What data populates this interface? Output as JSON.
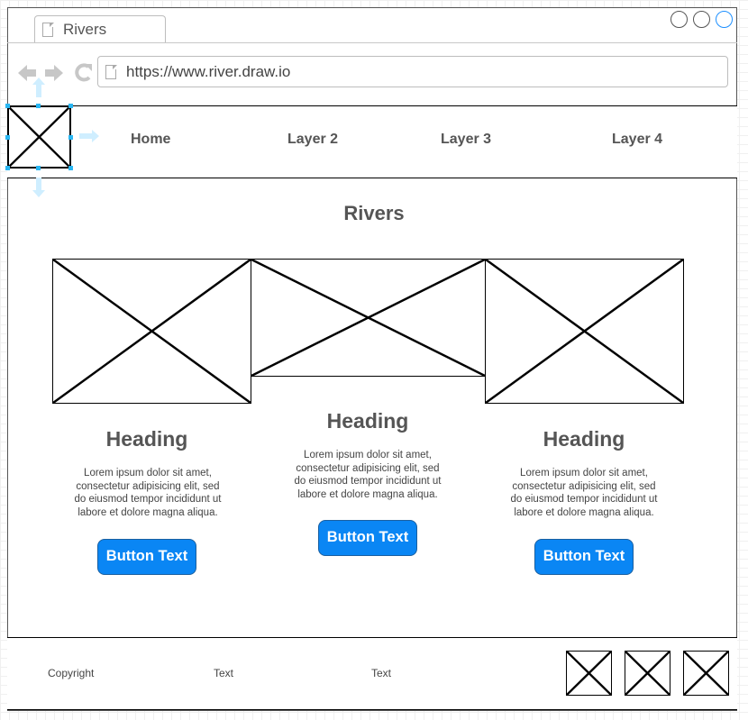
{
  "browser": {
    "tab_title": "Rivers",
    "url": "https://www.river.draw.io"
  },
  "nav": {
    "items": [
      "Home",
      "Layer 2",
      "Layer 3",
      "Layer 4"
    ]
  },
  "main": {
    "title": "Rivers",
    "cards": [
      {
        "heading": "Heading",
        "body_lines": [
          "Lorem ipsum dolor sit amet,",
          "consectetur adipisicing elit, sed",
          "do eiusmod tempor incididunt ut",
          "labore et dolore magna aliqua."
        ],
        "button": "Button Text"
      },
      {
        "heading": "Heading",
        "body_lines": [
          "Lorem ipsum dolor sit amet,",
          "consectetur adipisicing elit, sed",
          "do eiusmod tempor incididunt ut",
          "labore et dolore magna aliqua."
        ],
        "button": "Button Text"
      },
      {
        "heading": "Heading",
        "body_lines": [
          "Lorem ipsum dolor sit amet,",
          "consectetur adipisicing elit, sed",
          "do eiusmod tempor incididunt ut",
          "labore et dolore magna aliqua."
        ],
        "button": "Button Text"
      }
    ]
  },
  "footer": {
    "copyright": "Copyright",
    "text_1": "Text",
    "text_2": "Text"
  },
  "colors": {
    "button_bg": "#0a86f4",
    "text_gray": "#555555",
    "selection_blue": "#29b6f2"
  },
  "icons": [
    "back-arrow-icon",
    "forward-arrow-icon",
    "reload-icon",
    "page-icon",
    "image-placeholder-icon"
  ]
}
